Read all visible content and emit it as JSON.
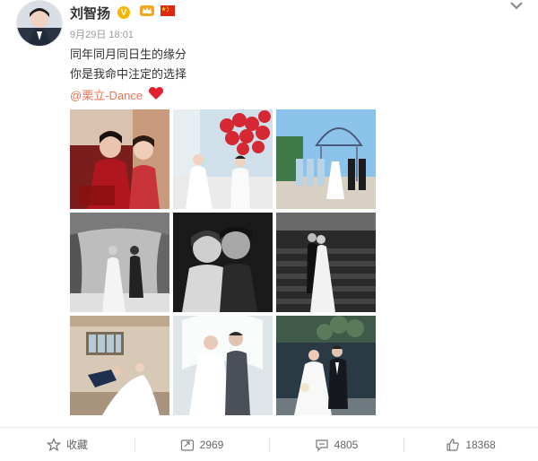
{
  "post": {
    "user_name": "刘智扬",
    "badge_v": "V",
    "timestamp": "9月29日 18:01",
    "lines": [
      "同年同月同日生的缘分",
      "你是我命中注定的选择"
    ],
    "mention": "@栗立-Dance",
    "heart_icon": "heart-icon",
    "images": [
      {
        "name": "photo-1"
      },
      {
        "name": "photo-2"
      },
      {
        "name": "photo-3"
      },
      {
        "name": "photo-4"
      },
      {
        "name": "photo-5"
      },
      {
        "name": "photo-6"
      },
      {
        "name": "photo-7"
      },
      {
        "name": "photo-8"
      },
      {
        "name": "photo-9"
      }
    ]
  },
  "actions": {
    "favorite_label": "收藏",
    "repost_count": "2969",
    "comment_count": "4805",
    "like_count": "18368"
  },
  "colors": {
    "mention": "#eb7350",
    "badge_v": "#f7b500",
    "heart": "#e0202c"
  }
}
